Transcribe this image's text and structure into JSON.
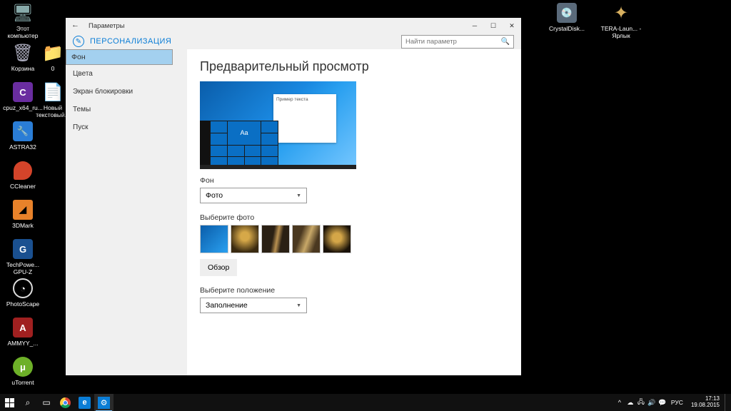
{
  "desktop": [
    {
      "label": "Этот компьютер",
      "bg": "#4a5d6a",
      "glyph": "🖥"
    },
    {
      "label": "Корзина",
      "bg": "#8aa0b0",
      "glyph": "🗑"
    },
    {
      "label": "0",
      "bg": "#f5d568",
      "glyph": "📁"
    },
    {
      "label": "cpuz_x64_ru...",
      "bg": "#6a2da0",
      "glyph": "C"
    },
    {
      "label": "Новый текстовый...",
      "bg": "#fff",
      "glyph": "📄"
    },
    {
      "label": "ASTRA32",
      "bg": "#0a5daa",
      "glyph": "A"
    },
    {
      "label": "CCleaner",
      "bg": "#d4442a",
      "glyph": "C"
    },
    {
      "label": "3DMark",
      "bg": "#000",
      "glyph": "▶"
    },
    {
      "label": "TechPowe... GPU-Z",
      "bg": "#1a5090",
      "glyph": "G"
    },
    {
      "label": "PhotoScape",
      "bg": "#000",
      "glyph": "◔"
    },
    {
      "label": "AMMYY_...",
      "bg": "#8a1818",
      "glyph": "A"
    },
    {
      "label": "uTorrent",
      "bg": "#6db028",
      "glyph": "μ"
    },
    {
      "label": "CrystalDisk...",
      "bg": "#5a6a7a",
      "glyph": "💿"
    },
    {
      "label": "TERA-Laun... - Ярлык",
      "bg": "#000",
      "glyph": "✦"
    }
  ],
  "window": {
    "title": "Параметры",
    "heading": "ПЕРСОНАЛИЗАЦИЯ",
    "search_placeholder": "Найти параметр",
    "nav": [
      "Фон",
      "Цвета",
      "Экран блокировки",
      "Темы",
      "Пуск"
    ],
    "nav_selected": 0,
    "content": {
      "title": "Предварительный просмотр",
      "preview_sample": "Пример текста",
      "bg_label": "Фон",
      "bg_value": "Фото",
      "choose_label": "Выберите фото",
      "browse": "Обзор",
      "fit_label": "Выберите положение",
      "fit_value": "Заполнение"
    }
  },
  "taskbar": {
    "lang": "РУС",
    "time": "17:13",
    "date": "19.08.2015"
  }
}
